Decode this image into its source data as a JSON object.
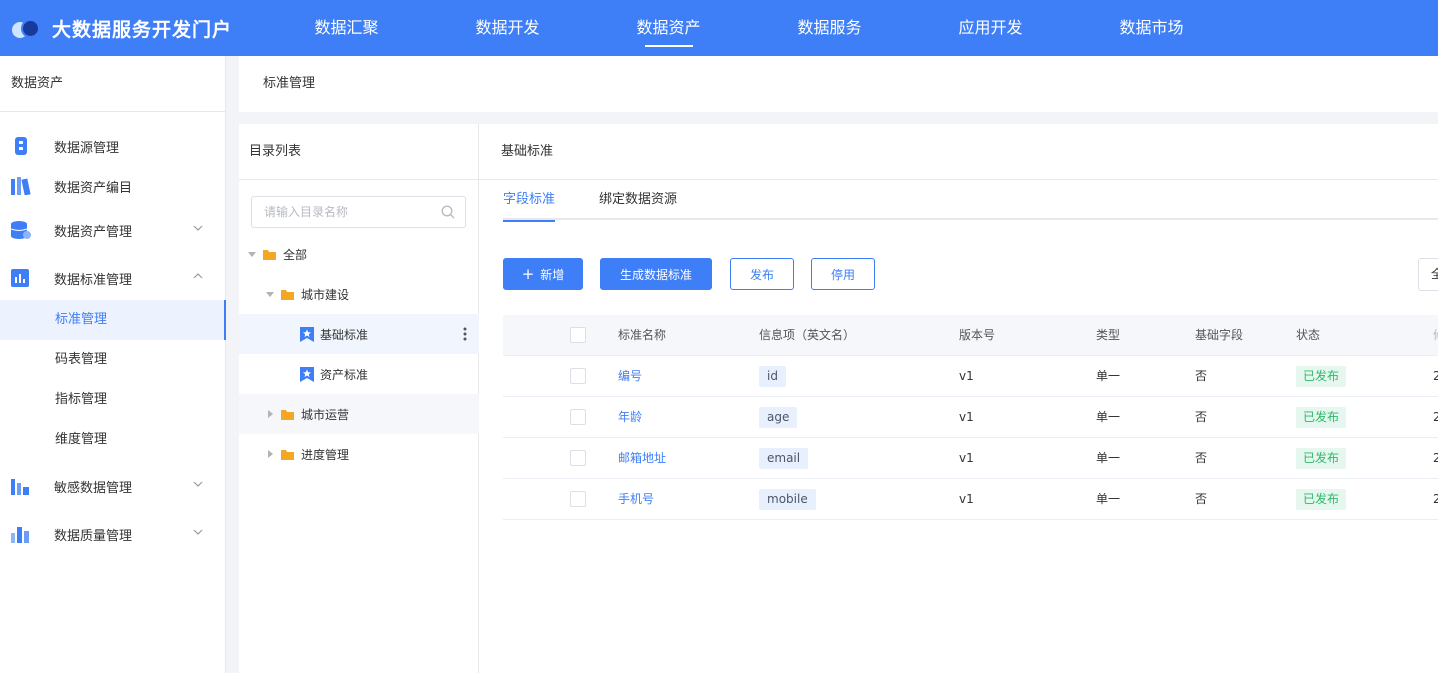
{
  "header": {
    "brand_title": "大数据服务开发门户",
    "nav": [
      "数据汇聚",
      "数据开发",
      "数据资产",
      "数据服务",
      "应用开发",
      "数据市场"
    ],
    "active_nav": "数据资产"
  },
  "sidebar": {
    "title": "数据资产",
    "groups": [
      {
        "label": "数据源管理",
        "icon": "datasource-icon"
      },
      {
        "label": "数据资产编目",
        "icon": "catalog-books-icon"
      },
      {
        "label": "数据资产管理",
        "icon": "database-gear-icon"
      },
      {
        "label": "数据标准管理",
        "icon": "standard-chart-icon"
      },
      {
        "label": "敏感数据管理",
        "icon": "sensitive-data-icon"
      },
      {
        "label": "数据质量管理",
        "icon": "quality-bars-icon"
      }
    ],
    "subitems": [
      "标准管理",
      "码表管理",
      "指标管理",
      "维度管理"
    ]
  },
  "breadcrumb": "标准管理",
  "directory": {
    "title": "目录列表",
    "search_placeholder": "请输入目录名称",
    "nodes": {
      "all": "全部",
      "city_build": "城市建设",
      "basic_std": "基础标准",
      "asset_std": "资产标准",
      "city_ops": "城市运营",
      "progress": "进度管理"
    }
  },
  "main": {
    "title": "基础标准",
    "tabs": [
      "字段标准",
      "绑定数据资源"
    ],
    "buttons": {
      "add": "新增",
      "plus": "+",
      "generate": "生成数据标准",
      "publish": "发布",
      "disable": "停用"
    },
    "right_select": "全",
    "columns": [
      "标准名称",
      "信息项（英文名）",
      "版本号",
      "类型",
      "基础字段",
      "状态",
      "修"
    ],
    "rows": [
      {
        "name": "编号",
        "en": "id",
        "version": "v1",
        "type": "单一",
        "basic": "否",
        "status": "已发布",
        "extra": "2"
      },
      {
        "name": "年龄",
        "en": "age",
        "version": "v1",
        "type": "单一",
        "basic": "否",
        "status": "已发布",
        "extra": "2"
      },
      {
        "name": "邮箱地址",
        "en": "email",
        "version": "v1",
        "type": "单一",
        "basic": "否",
        "status": "已发布",
        "extra": "2"
      },
      {
        "name": "手机号",
        "en": "mobile",
        "version": "v1",
        "type": "单一",
        "basic": "否",
        "status": "已发布",
        "extra": "2"
      }
    ]
  },
  "colors": {
    "primary": "#3e7ef7",
    "success": "#2fb86a",
    "folder": "#f5a623"
  }
}
